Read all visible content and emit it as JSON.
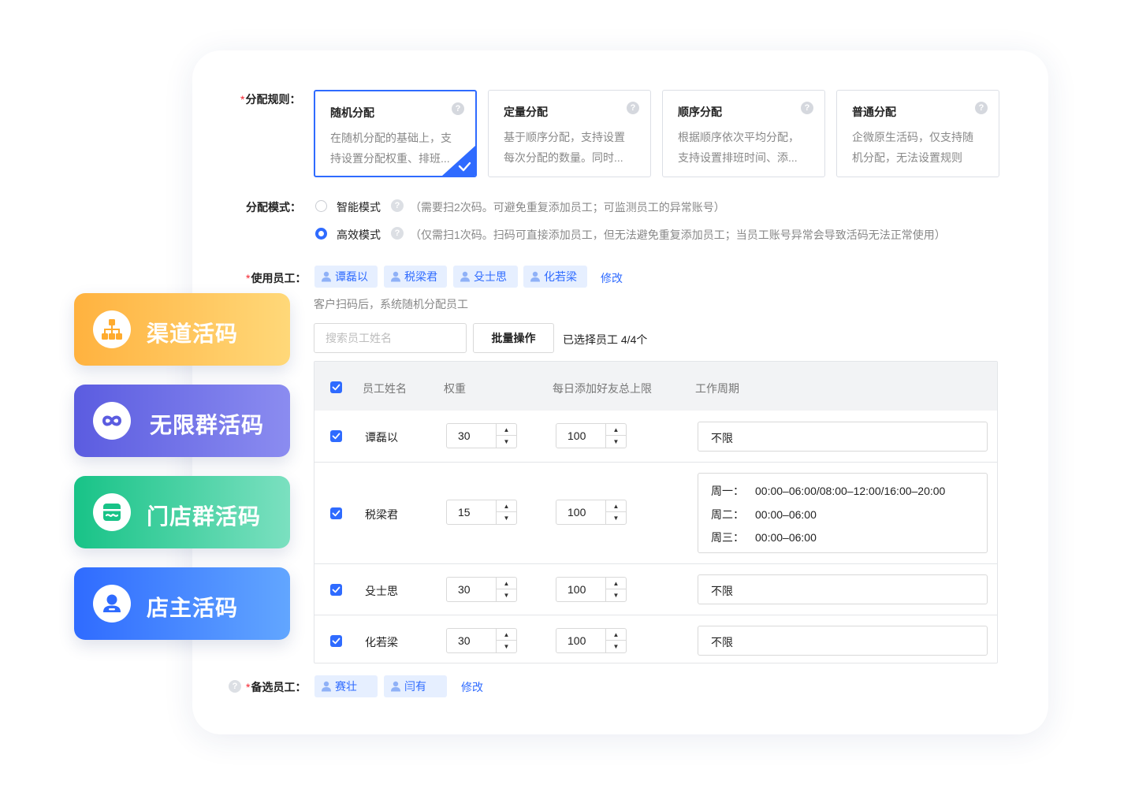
{
  "rules": {
    "label_required": "*",
    "label": "分配规则：",
    "cards": [
      {
        "title": "随机分配",
        "line1": "在随机分配的基础上，支",
        "line2": "持设置分配权重、排班..."
      },
      {
        "title": "定量分配",
        "line1": "基于顺序分配，支持设置",
        "line2": "每次分配的数量。同时..."
      },
      {
        "title": "顺序分配",
        "line1": "根据顺序依次平均分配，",
        "line2": "支持设置排班时间、添..."
      },
      {
        "title": "普通分配",
        "line1": "企微原生活码，仅支持随",
        "line2": "机分配，无法设置规则"
      }
    ],
    "selected_index": 0,
    "help_glyph": "?"
  },
  "mode": {
    "label": "分配模式：",
    "options": [
      {
        "label": "智能模式",
        "hint": "（需要扫2次码。可避免重复添加员工；可监测员工的异常账号）",
        "selected": false
      },
      {
        "label": "高效模式",
        "hint": "（仅需扫1次码。扫码可直接添加员工，但无法避免重复添加员工；当员工账号异常会导致活码无法正常使用）",
        "selected": true
      }
    ]
  },
  "employees": {
    "label_required": "*",
    "label": "使用员工：",
    "tags": [
      "谭磊以",
      "税梁君",
      "殳士思",
      "化若梁"
    ],
    "edit_link": "修改",
    "note": "客户扫码后，系统随机分配员工",
    "search_placeholder": "搜索员工姓名",
    "batch_button": "批量操作",
    "selected_count": "已选择员工 4/4个"
  },
  "table": {
    "headers": {
      "name": "员工姓名",
      "weight": "权重",
      "limit": "每日添加好友总上限",
      "period": "工作周期"
    },
    "rows": [
      {
        "name": "谭磊以",
        "weight": "30",
        "limit": "100",
        "period": "不限"
      },
      {
        "name": "税梁君",
        "weight": "15",
        "limit": "100",
        "schedule": [
          {
            "day": "周一：",
            "time": "00:00–06:00/08:00–12:00/16:00–20:00"
          },
          {
            "day": "周二：",
            "time": "00:00–06:00"
          },
          {
            "day": "周三：",
            "time": "00:00–06:00"
          }
        ]
      },
      {
        "name": "殳士思",
        "weight": "30",
        "limit": "100",
        "period": "不限"
      },
      {
        "name": "化若梁",
        "weight": "30",
        "limit": "100",
        "period": "不限"
      }
    ]
  },
  "backup": {
    "label_required": "*",
    "label": "备选员工：",
    "tags": [
      "赛壮",
      "闫有"
    ],
    "edit_link": "修改"
  },
  "features": [
    {
      "label": "渠道活码",
      "icon": "org-chart-icon",
      "color_from": "#ffb23f",
      "color_to": "#ffd879"
    },
    {
      "label": "无限群活码",
      "icon": "infinity-icon",
      "color_from": "#5b5ce0",
      "color_to": "#8b8cf0"
    },
    {
      "label": "门店群活码",
      "icon": "store-icon",
      "color_from": "#18c387",
      "color_to": "#7be0c0"
    },
    {
      "label": "店主活码",
      "icon": "user-icon",
      "color_from": "#2f6bff",
      "color_to": "#62a6ff"
    }
  ],
  "colors": {
    "accent": "#2f6bff",
    "tag_bg": "#e6efff",
    "required": "#f5222d"
  }
}
